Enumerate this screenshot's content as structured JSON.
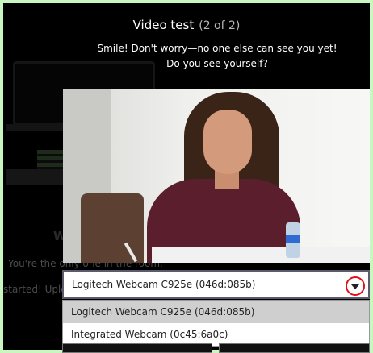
{
  "dialog": {
    "title": "Video test",
    "step": "(2 of 2)",
    "message_line1": "Smile! Don't worry—no one else can see you yet!",
    "message_line2": "Do you see yourself?"
  },
  "background": {
    "letter": "W",
    "line1": "You're the only one in the room.",
    "line2": "started! Uplo"
  },
  "camera_select": {
    "selected": "Logitech Webcam C925e (046d:085b)",
    "options": [
      "Logitech Webcam C925e (046d:085b)",
      "Integrated Webcam (0c45:6a0c)"
    ]
  },
  "icons": {
    "dropdown": "chevron-down-icon"
  },
  "colors": {
    "dropdown_ring": "#e0101a",
    "page_bg": "#000000",
    "selected_option_bg": "#cfcfcf"
  }
}
